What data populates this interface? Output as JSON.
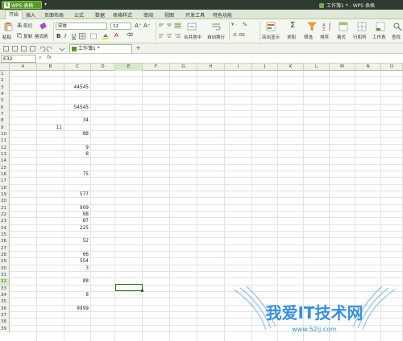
{
  "app": {
    "name": "WPS 表格",
    "logo": "S",
    "document_title": "工作簿1 * - WPS 表格"
  },
  "menu_tabs": [
    "开始",
    "插入",
    "页面布局",
    "公式",
    "数据",
    "表格样式",
    "审阅",
    "视图",
    "开发工具",
    "特色功能"
  ],
  "ribbon": {
    "paste": "粘贴",
    "cut": "剪切",
    "copy": "复制",
    "format_painter": "格式刷",
    "font_name": "宋体",
    "font_size": "12",
    "bold": "B",
    "italic": "I",
    "underline": "U",
    "merge_center": "合并居中",
    "wrap_text": "自动换行",
    "percent": "%",
    "conditional": "突出显示",
    "sum": "求和",
    "filter": "筛选",
    "sort": "排序",
    "format": "格式",
    "row_col": "行和列",
    "sheet": "工作表",
    "find": "查找"
  },
  "sheet_tab": "工作簿1 *",
  "formula_bar": {
    "name_box": "E32",
    "fx": "fx",
    "value": ""
  },
  "columns": [
    "A",
    "B",
    "C",
    "D",
    "E",
    "F",
    "G",
    "H",
    "I",
    "J",
    "K",
    "L",
    "M",
    "N",
    "O"
  ],
  "selected_column": "E",
  "selected_row": 32,
  "row_count": 39,
  "cells": [
    {
      "row": 3,
      "col": "C",
      "value": "44545"
    },
    {
      "row": 6,
      "col": "C",
      "value": "54545"
    },
    {
      "row": 8,
      "col": "C",
      "value": "34"
    },
    {
      "row": 9,
      "col": "B",
      "value": "11"
    },
    {
      "row": 10,
      "col": "C",
      "value": "88"
    },
    {
      "row": 12,
      "col": "C",
      "value": "9"
    },
    {
      "row": 13,
      "col": "C",
      "value": "8"
    },
    {
      "row": 16,
      "col": "C",
      "value": "75"
    },
    {
      "row": 19,
      "col": "C",
      "value": "577"
    },
    {
      "row": 21,
      "col": "C",
      "value": "909"
    },
    {
      "row": 22,
      "col": "C",
      "value": "98"
    },
    {
      "row": 23,
      "col": "C",
      "value": "87"
    },
    {
      "row": 24,
      "col": "C",
      "value": "225"
    },
    {
      "row": 26,
      "col": "C",
      "value": "52"
    },
    {
      "row": 28,
      "col": "C",
      "value": "66"
    },
    {
      "row": 29,
      "col": "C",
      "value": "554"
    },
    {
      "row": 30,
      "col": "C",
      "value": "3"
    },
    {
      "row": 32,
      "col": "C",
      "value": "88"
    },
    {
      "row": 34,
      "col": "C",
      "value": "8"
    },
    {
      "row": 36,
      "col": "C",
      "value": "8999"
    }
  ],
  "watermark": {
    "text": "我爱IT技术网",
    "url": "www.52ij.com"
  },
  "colors": {
    "accent": "#5a9a2c",
    "title_bg": "#2f3a2f",
    "selection": "#2e6b1e"
  }
}
